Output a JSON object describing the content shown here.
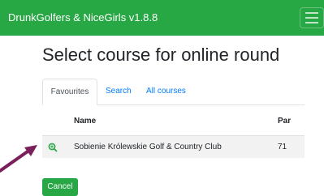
{
  "navbar": {
    "brand": "DrunkGolfers & NiceGirls v1.8.8",
    "menu_icon": "hamburger-menu-icon"
  },
  "page": {
    "title": "Select course for online round"
  },
  "tabs": [
    {
      "label": "Favourites",
      "active": true
    },
    {
      "label": "Search",
      "active": false
    },
    {
      "label": "All courses",
      "active": false
    }
  ],
  "table": {
    "headers": {
      "name": "Name",
      "par": "Par"
    },
    "rows": [
      {
        "icon": "zoom-in-icon",
        "name": "Sobienie Królewskie Golf & Country Club",
        "par": "71"
      }
    ]
  },
  "actions": {
    "cancel_label": "Cancel"
  },
  "colors": {
    "brand_green": "#28a745",
    "link_blue": "#007bff",
    "annotation_arrow": "#7b1f5c"
  }
}
